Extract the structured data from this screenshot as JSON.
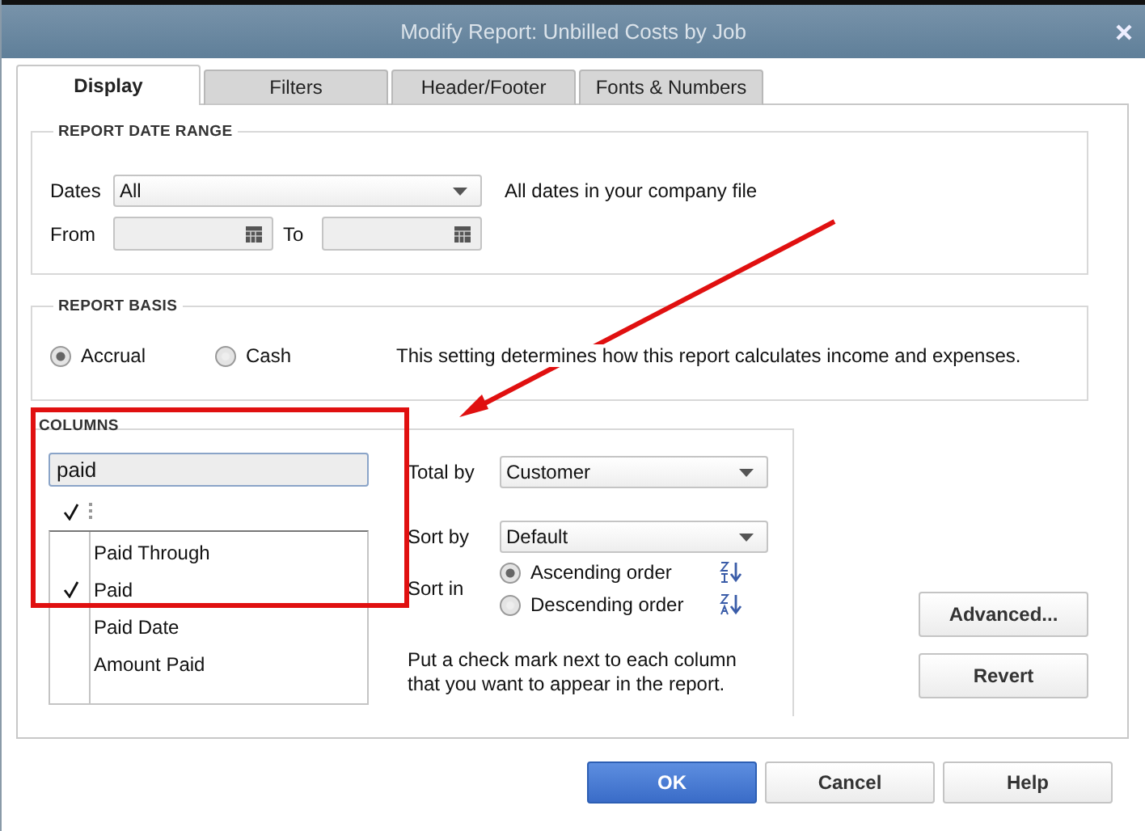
{
  "window": {
    "title": "Modify Report: Unbilled Costs by Job"
  },
  "tabs": [
    {
      "label": "Display",
      "selected": true
    },
    {
      "label": "Filters",
      "selected": false
    },
    {
      "label": "Header/Footer",
      "selected": false
    },
    {
      "label": "Fonts & Numbers",
      "selected": false
    }
  ],
  "date_range": {
    "heading": "REPORT DATE RANGE",
    "dates_label": "Dates",
    "dates_value": "All",
    "dates_note": "All dates in your company file",
    "from_label": "From",
    "to_label": "To"
  },
  "report_basis": {
    "heading": "REPORT BASIS",
    "options": [
      {
        "label": "Accrual",
        "selected": true
      },
      {
        "label": "Cash",
        "selected": false
      }
    ],
    "note": "This setting determines how this report calculates income and expenses."
  },
  "columns": {
    "heading": "COLUMNS",
    "search_value": "paid",
    "items": [
      {
        "label": "Paid Through",
        "checked": false
      },
      {
        "label": "Paid",
        "checked": true
      },
      {
        "label": "Paid Date",
        "checked": false
      },
      {
        "label": "Amount Paid",
        "checked": false
      }
    ],
    "total_by": {
      "label": "Total by",
      "value": "Customer"
    },
    "sort_by": {
      "label": "Sort by",
      "value": "Default"
    },
    "sort_in": {
      "label": "Sort in",
      "options": [
        {
          "label": "Ascending order",
          "selected": true,
          "kind": "ascending"
        },
        {
          "label": "Descending order",
          "selected": false,
          "kind": "descending"
        }
      ]
    },
    "hint": "Put a check mark next to each column that you want to appear in the report."
  },
  "side_buttons": [
    "Advanced...",
    "Revert"
  ],
  "footer_buttons": [
    {
      "label": "OK",
      "kind": "primary"
    },
    {
      "label": "Cancel",
      "kind": "normal"
    },
    {
      "label": "Help",
      "kind": "normal"
    }
  ]
}
